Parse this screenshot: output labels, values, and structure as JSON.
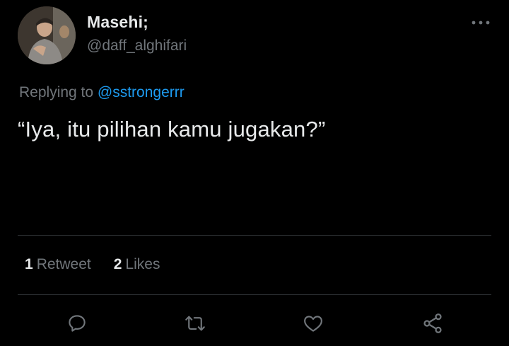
{
  "author": {
    "display_name": "Masehi;",
    "handle": "@daff_alghifari"
  },
  "reply": {
    "prefix": "Replying to ",
    "mention": "@sstrongerrr"
  },
  "tweet": {
    "text": "“Iya, itu pilihan kamu jugakan?”"
  },
  "stats": {
    "retweet_count": "1",
    "retweet_label": "Retweet",
    "like_count": "2",
    "like_label": "Likes"
  },
  "actions": {
    "reply_icon": "reply-icon",
    "retweet_icon": "retweet-icon",
    "like_icon": "heart-icon",
    "share_icon": "share-icon"
  },
  "colors": {
    "background": "#000000",
    "text_primary": "#e7e9ea",
    "text_secondary": "#71767b",
    "accent": "#1d9bf0",
    "divider": "#2f3336"
  }
}
